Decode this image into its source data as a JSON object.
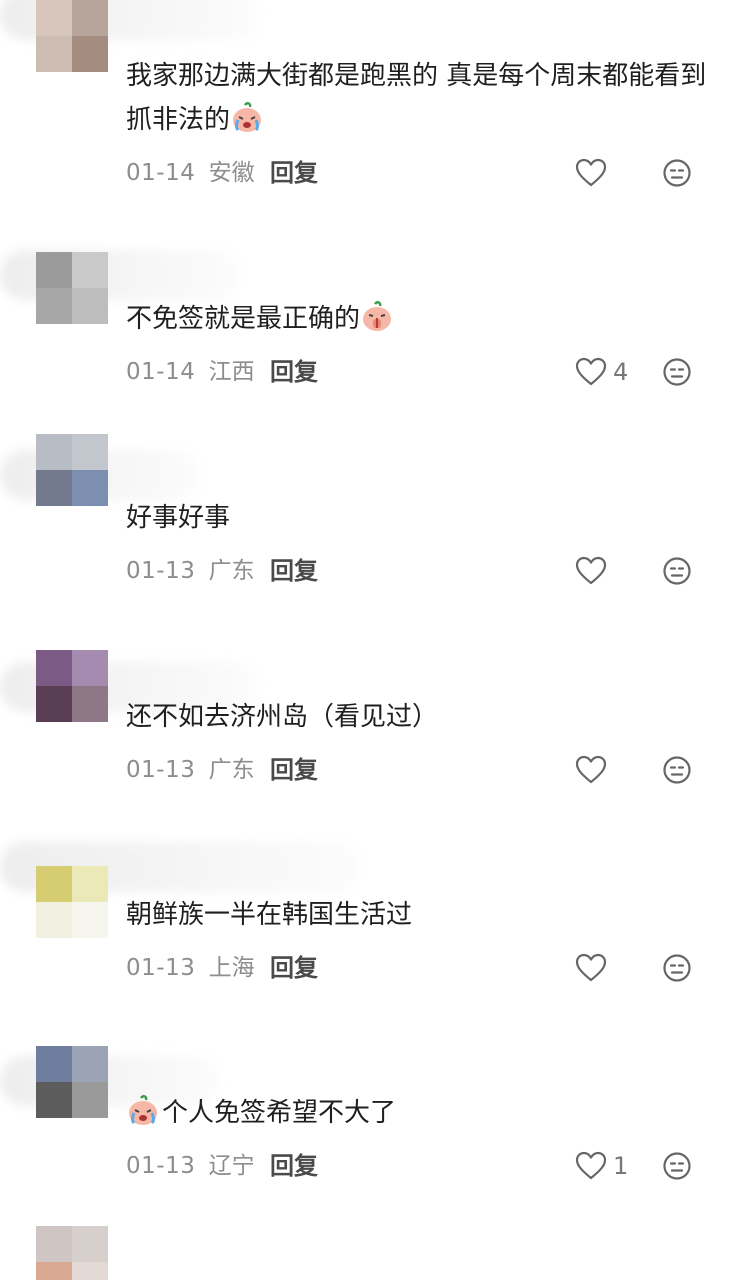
{
  "reply_label": "回复",
  "comments": [
    {
      "text": "我家那边满大街都是跑黑的 真是每个周末都能看到抓非法的",
      "date": "01-14",
      "location": "安徽",
      "likes": "",
      "emoji": "crying-laugh-emoji",
      "avatar_colors": [
        "#d8c6bd",
        "#b7a49a",
        "#cdbcb2",
        "#a58c80"
      ]
    },
    {
      "text": "不免签就是最正确的",
      "date": "01-14",
      "location": "江西",
      "likes": "4",
      "emoji": "shush-emoji",
      "avatar_colors": [
        "#9b9b9b",
        "#c9c9c9",
        "#a7a7a7",
        "#bdbdbd"
      ]
    },
    {
      "text": "好事好事",
      "date": "01-13",
      "location": "广东",
      "likes": "",
      "emoji": "",
      "avatar_colors": [
        "#b8bcc4",
        "#c2c7cd",
        "#737a8d",
        "#7d8fb0"
      ]
    },
    {
      "text": "还不如去济州岛（看见过）",
      "date": "01-13",
      "location": "广东",
      "likes": "",
      "emoji": "",
      "avatar_colors": [
        "#7b5a86",
        "#a58bb0",
        "#5a3f54",
        "#8e7888"
      ]
    },
    {
      "text": "朝鲜族一半在韩国生活过",
      "date": "01-13",
      "location": "上海",
      "likes": "",
      "emoji": "",
      "avatar_colors": [
        "#d6cc72",
        "#ece9b8",
        "#f2f0e0",
        "#f7f6ee"
      ]
    },
    {
      "text": "个人免签希望不大了",
      "date": "01-13",
      "location": "辽宁",
      "likes": "1",
      "emoji": "crying-laugh-emoji",
      "avatar_colors": [
        "#6f7e9e",
        "#9ba3b4",
        "#5c5c5c",
        "#9a9a9a"
      ]
    },
    {
      "text": "",
      "date": "",
      "location": "",
      "likes": "",
      "emoji": "",
      "avatar_colors": [
        "#cfc6c4",
        "#d6cfcc",
        "#d8a890",
        "#e2d8d4"
      ]
    }
  ]
}
